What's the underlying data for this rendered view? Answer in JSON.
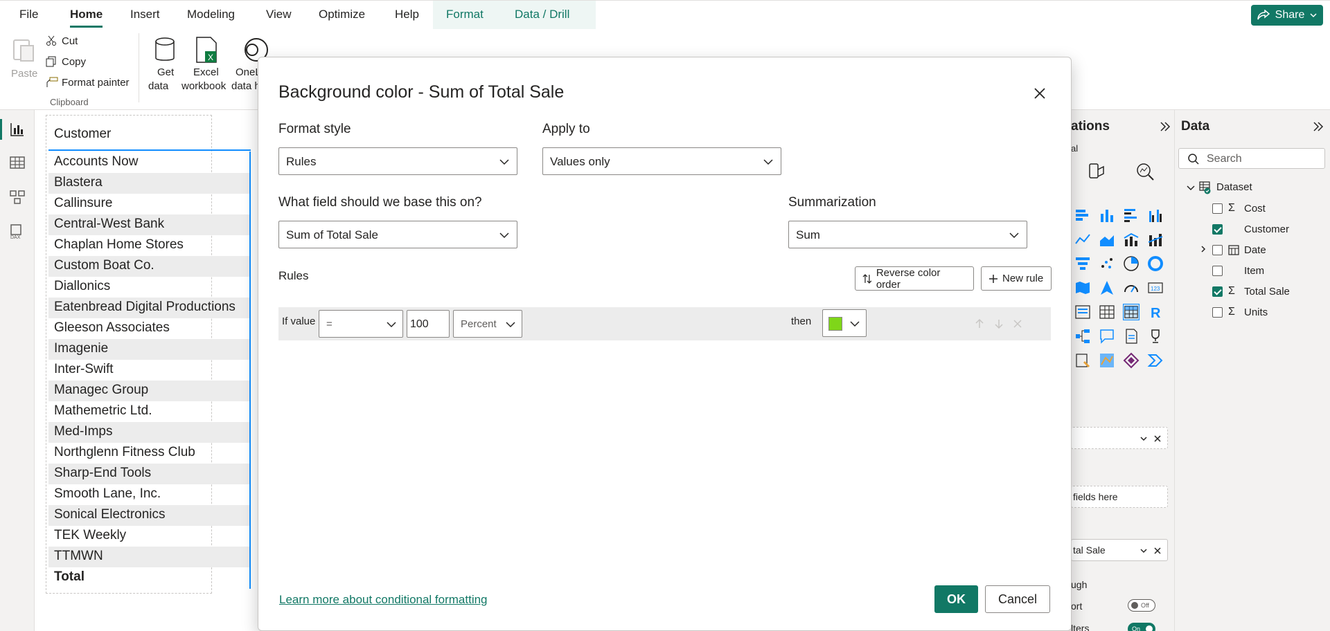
{
  "menu": {
    "tabs": [
      "File",
      "Home",
      "Insert",
      "Modeling",
      "View",
      "Optimize",
      "Help",
      "Format",
      "Data / Drill"
    ],
    "active": "Home",
    "share_label": "Share"
  },
  "ribbon": {
    "paste": "Paste",
    "cut": "Cut",
    "copy": "Copy",
    "format_painter": "Format painter",
    "clipboard_group": "Clipboard",
    "get_data_1": "Get",
    "get_data_2": "data",
    "excel_1": "Excel",
    "excel_2": "workbook",
    "onelake_1": "OneL",
    "onelake_2": "data h"
  },
  "table": {
    "header": "Customer",
    "rows": [
      "Accounts Now",
      "Blastera",
      "Callinsure",
      "Central-West Bank",
      "Chaplan Home Stores",
      "Custom Boat Co.",
      "Diallonics",
      "Eatenbread Digital Productions",
      "Gleeson Associates",
      "Imagenie",
      "Inter-Swift",
      "Managec Group",
      "Mathemetric Ltd.",
      "Med-Imps",
      "Northglenn Fitness Club",
      "Sharp-End Tools",
      "Smooth Lane, Inc.",
      "Sonical Electronics",
      "TEK Weekly",
      "TTMWN"
    ],
    "total": "Total"
  },
  "viz_pane": {
    "title": "ations",
    "sub": "al",
    "well_placeholder": "fields here",
    "well_value": "tal Sale",
    "drill_label": "ugh",
    "report_label": "ort",
    "filters_label": "lters",
    "toggle_off": "Off",
    "toggle_on": "On"
  },
  "data_pane": {
    "title": "Data",
    "search_placeholder": "Search",
    "dataset": "Dataset",
    "fields": [
      {
        "name": "Cost",
        "checked": false,
        "sigma": true
      },
      {
        "name": "Customer",
        "checked": true,
        "sigma": false
      },
      {
        "name": "Date",
        "checked": false,
        "sigma": false
      },
      {
        "name": "Item",
        "checked": false,
        "sigma": false
      },
      {
        "name": "Total Sale",
        "checked": true,
        "sigma": true
      },
      {
        "name": "Units",
        "checked": false,
        "sigma": true
      }
    ]
  },
  "dialog": {
    "title": "Background color - Sum of Total Sale",
    "format_style_label": "Format style",
    "format_style_value": "Rules",
    "apply_to_label": "Apply to",
    "apply_to_value": "Values only",
    "field_label": "What field should we base this on?",
    "field_value": "Sum of Total Sale",
    "summarization_label": "Summarization",
    "summarization_value": "Sum",
    "rules_label": "Rules",
    "reverse_label": "Reverse color order",
    "new_rule_label": "New rule",
    "rule": {
      "if_label": "If value",
      "operator": "=",
      "value": "100",
      "unit": "Percent",
      "then_label": "then",
      "color": "#7fd619"
    },
    "learn_more": "Learn more about conditional formatting",
    "ok": "OK",
    "cancel": "Cancel"
  },
  "colors": {
    "accent": "#117865",
    "selection": "#118dff"
  }
}
